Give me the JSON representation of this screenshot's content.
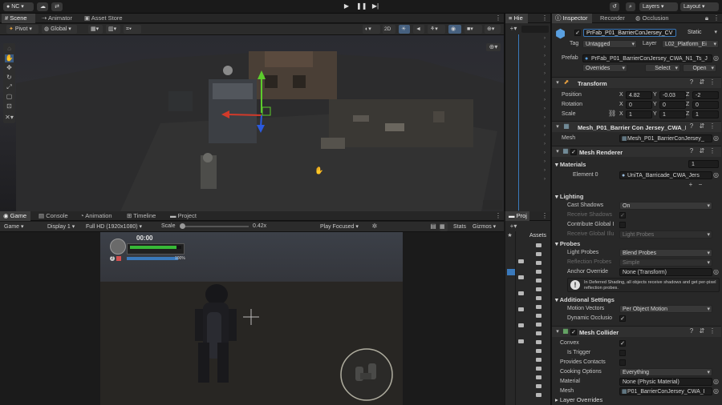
{
  "toolbar": {
    "account": "NC",
    "layers": "Layers",
    "layout": "Layout"
  },
  "scene_tabs": [
    {
      "label": "Scene"
    },
    {
      "label": "Animator"
    },
    {
      "label": "Asset Store"
    }
  ],
  "scene_toolbar": {
    "pivot": "Pivot",
    "global": "Global",
    "mode_2d": "2D"
  },
  "hierarchy_tab": "Hie",
  "game_tabs": [
    {
      "label": "Game"
    },
    {
      "label": "Console"
    },
    {
      "label": "Animation"
    },
    {
      "label": "Timeline"
    },
    {
      "label": "Project"
    }
  ],
  "game_toolbar": {
    "view": "Game",
    "display": "Display 1",
    "resolution": "Full HD (1920x1080)",
    "scale_label": "Scale",
    "scale_value": "0.42x",
    "play_mode": "Play Focused",
    "stats": "Stats",
    "gizmos": "Gizmos"
  },
  "hud": {
    "timer": "00:00",
    "percent": "100%",
    "health_fraction": 0.9,
    "shield_fraction": 1.0
  },
  "project_tab": "Proj",
  "project_assets": "Assets",
  "inspector_tabs": [
    {
      "label": "Inspector"
    },
    {
      "label": "Recorder"
    },
    {
      "label": "Occlusion"
    }
  ],
  "object": {
    "name": "PrFab_P01_BarrierConJersey_CV",
    "static": "Static",
    "tag_label": "Tag",
    "tag": "Untagged",
    "layer_label": "Layer",
    "layer": "L02_Platform_Ei",
    "prefab_label": "Prefab",
    "prefab": "PrFab_P01_BarrierConJersey_CWA_N1_Ts_J",
    "overrides": "Overrides",
    "select": "Select",
    "open": "Open"
  },
  "transform": {
    "title": "Transform",
    "position_label": "Position",
    "rotation_label": "Rotation",
    "scale_label": "Scale",
    "position": {
      "x": "4.82",
      "y": "-0.03",
      "z": "-2"
    },
    "rotation": {
      "x": "0",
      "y": "0",
      "z": "0"
    },
    "scale": {
      "x": "1",
      "y": "1",
      "z": "1"
    },
    "axes": {
      "x": "X",
      "y": "Y",
      "z": "Z"
    }
  },
  "mesh_filter": {
    "title": "Mesh_P01_Barrier Con Jersey_CWA_N",
    "mesh_label": "Mesh",
    "mesh": "Mesh_P01_BarrierConJersey_"
  },
  "mesh_renderer": {
    "title": "Mesh Renderer",
    "materials_label": "Materials",
    "materials_count": "1",
    "element0_label": "Element 0",
    "element0": "UniTA_Barricade_CWA_Jers",
    "plus": "+",
    "minus": "−",
    "lighting": "Lighting",
    "cast_shadows_label": "Cast Shadows",
    "cast_shadows": "On",
    "receive_shadows_label": "Receive Shadows",
    "contribute_gi_label": "Contribute Global I",
    "receive_gi_label": "Receive Global Illu",
    "receive_gi": "Light Probes",
    "probes": "Probes",
    "light_probes_label": "Light Probes",
    "light_probes": "Blend Probes",
    "reflection_probes_label": "Reflection Probes",
    "reflection_probes": "Simple",
    "anchor_override_label": "Anchor Override",
    "anchor_override": "None (Transform)",
    "info": "In Deferred Shading, all objects receive shadows and get per-pixel reflection probes.",
    "additional_settings": "Additional Settings",
    "motion_vectors_label": "Motion Vectors",
    "motion_vectors": "Per Object Motion",
    "dynamic_occlusion_label": "Dynamic Occlusio"
  },
  "mesh_collider": {
    "title": "Mesh Collider",
    "convex_label": "Convex",
    "is_trigger_label": "Is Trigger",
    "provides_contacts_label": "Provides Contacts",
    "cooking_options_label": "Cooking Options",
    "cooking_options": "Everything",
    "material_label": "Material",
    "material": "None (Physic Material)",
    "mesh_label": "Mesh",
    "mesh": "P01_BarrierConJersey_CWA_I"
  },
  "layer_overrides": "Layer Overrides",
  "colors": {
    "accent_blue": "#3a79bb",
    "gizmo_red": "#d23a2a",
    "gizmo_green": "#5ccc2c",
    "gizmo_blue": "#2a5ae0",
    "health_green": "#37b937"
  }
}
